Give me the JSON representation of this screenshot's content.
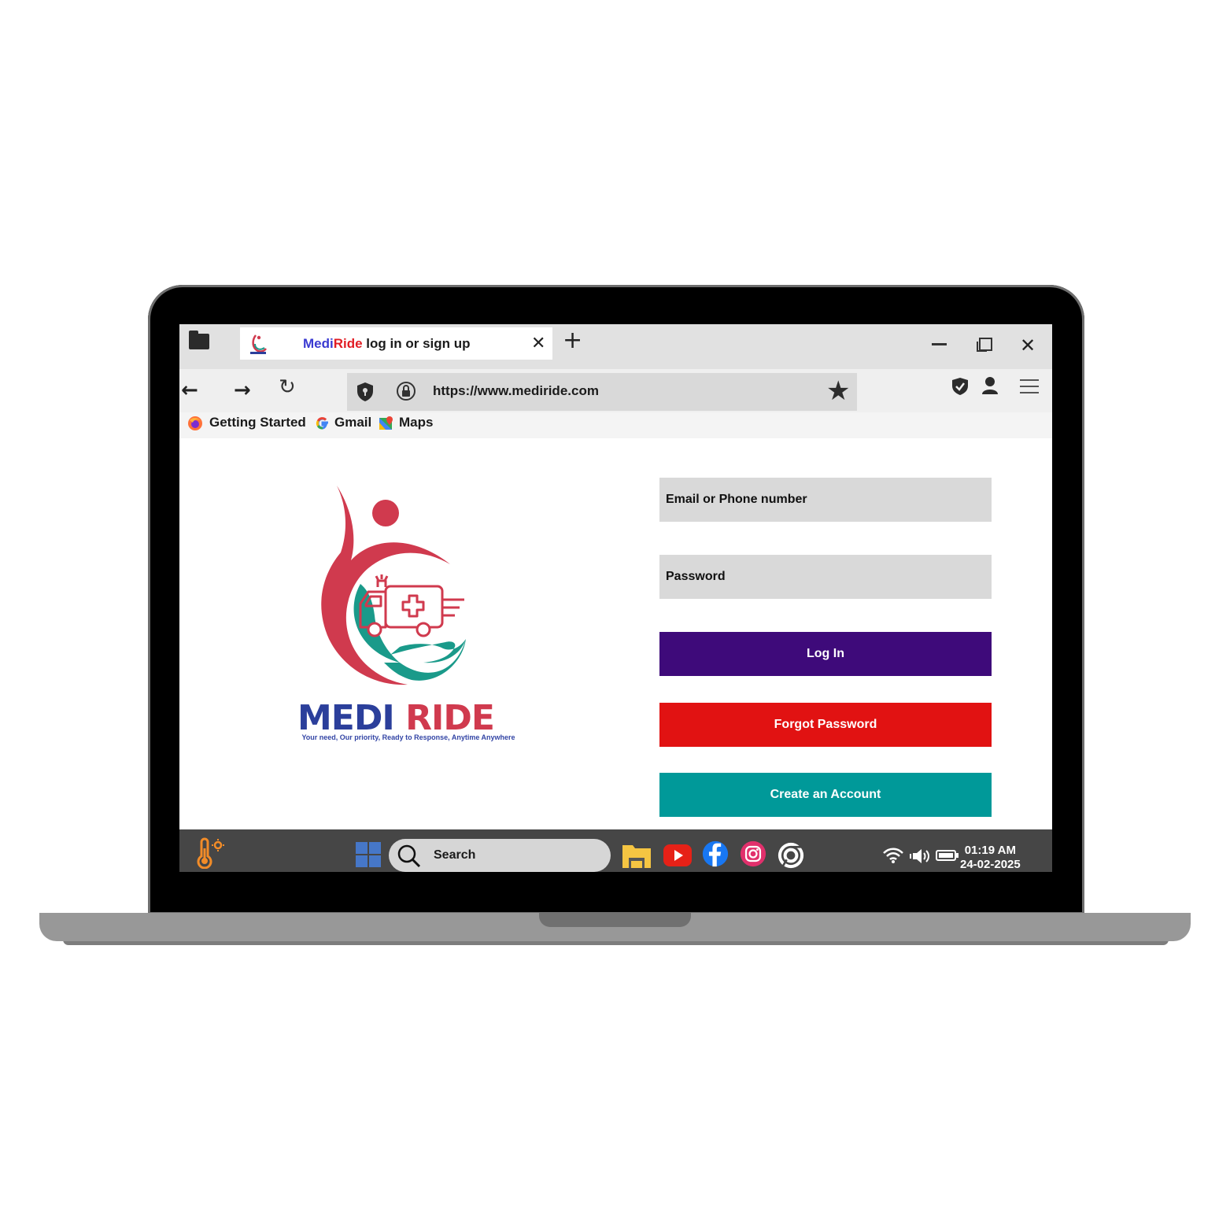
{
  "browser": {
    "tab": {
      "title_part1": "Medi",
      "title_part2": "Ride",
      "title_rest": " log in or sign up"
    },
    "url": "https://www.mediride.com",
    "bookmarks": [
      {
        "label": "Getting Started",
        "icon": "firefox-icon"
      },
      {
        "label": "Gmail",
        "icon": "google-icon"
      },
      {
        "label": "Maps",
        "icon": "maps-icon"
      }
    ]
  },
  "brand": {
    "name_part1": "MEDI",
    "name_part2": "RIDE",
    "tagline": "Your need, Our priority, Ready to Response, Anytime Anywhere"
  },
  "login": {
    "email_placeholder": "Email or Phone number",
    "password_placeholder": "Password",
    "login_label": "Log In",
    "forgot_label": "Forgot Password",
    "create_label": "Create an Account"
  },
  "colors": {
    "login": "#3e0a7a",
    "forgot": "#e11212",
    "create": "#009999",
    "logo_red": "#d03a4e",
    "logo_teal": "#1a9a8a",
    "logo_blue": "#2b3f9b"
  },
  "taskbar": {
    "search_label": "Search",
    "time": "01:19 AM",
    "date": "24-02-2025",
    "apps": [
      "file-explorer-icon",
      "youtube-icon",
      "facebook-icon",
      "instagram-icon",
      "chrome-icon"
    ]
  }
}
